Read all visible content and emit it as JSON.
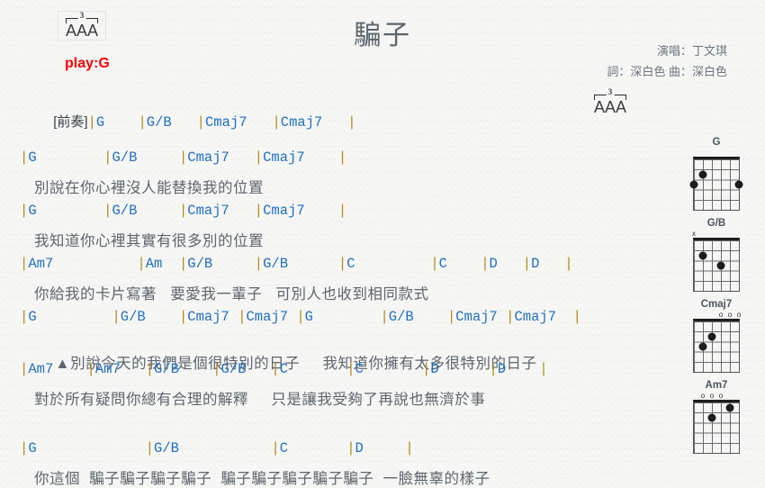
{
  "header": {
    "title": "騙子",
    "play_key": "play:G",
    "credit_singer": "演唱：丁文琪",
    "credit_writers": "詞：深白色   曲：深白色",
    "triplet_number": "3",
    "triplet_letters": "AAA"
  },
  "lines": [
    {
      "id": "intro-chords",
      "type": "chord",
      "tag": "[前奏]",
      "text": "|G    |G/B   |Cmaj7   |Cmaj7   |"
    },
    {
      "id": "verse1-chords-1",
      "type": "chord",
      "text": "|G        |G/B     |Cmaj7   |Cmaj7    |"
    },
    {
      "id": "verse1-lyric-1",
      "type": "lyric",
      "text": "別說在你心裡沒人能替換我的位置"
    },
    {
      "id": "verse1-chords-2",
      "type": "chord",
      "text": "|G        |G/B     |Cmaj7   |Cmaj7    |"
    },
    {
      "id": "verse1-lyric-2",
      "type": "lyric",
      "text": "我知道你心裡其實有很多別的位置"
    },
    {
      "id": "verse2-chords-1",
      "type": "chord",
      "text": "|Am7          |Am  |G/B     |G/B      |C         |C    |D   |D   |"
    },
    {
      "id": "verse2-lyric-1",
      "type": "lyric",
      "text": "你給我的卡片寫著   要愛我一輩子   可別人也收到相同款式"
    },
    {
      "id": "chorus-chords-1",
      "type": "chord",
      "text": "|G         |G/B    |Cmaj7 |Cmaj7 |G        |G/B    |Cmaj7 |Cmaj7  |"
    },
    {
      "id": "chorus-lyric-1",
      "type": "lyric",
      "marker": "▲",
      "text": "別說今天的我們是個很特別的日子     我知道你擁有太多很特別的日子"
    },
    {
      "id": "chorus-chords-2",
      "type": "chord",
      "text": "|Am7    |Am7   |G/B    |G/B   |C       |C       |D      |D    |"
    },
    {
      "id": "chorus-lyric-2",
      "type": "lyric",
      "text": "對於所有疑問你總有合理的解釋     只是讓我受夠了再說也無濟於事"
    },
    {
      "id": "outro-chords-1",
      "type": "chord",
      "text": "|G             |G/B           |C       |D     |"
    },
    {
      "id": "outro-lyric-1",
      "type": "lyric",
      "text": "你這個  騙子騙子騙子騙子  騙子騙子騙子騙子騙子  一臉無辜的樣子"
    }
  ],
  "chord_diagrams": [
    {
      "name": "G",
      "markers": [
        "",
        "",
        "",
        "",
        "",
        ""
      ],
      "dots": [
        {
          "string": 6,
          "fret": 3
        },
        {
          "string": 5,
          "fret": 2
        },
        {
          "string": 1,
          "fret": 3
        }
      ]
    },
    {
      "name": "G/B",
      "markers": [
        "x",
        "",
        "",
        "",
        "",
        ""
      ],
      "dots": [
        {
          "string": 5,
          "fret": 2
        },
        {
          "string": 3,
          "fret": 3
        }
      ]
    },
    {
      "name": "Cmaj7",
      "markers": [
        "",
        "",
        "",
        "o",
        "o",
        "o"
      ],
      "dots": [
        {
          "string": 5,
          "fret": 3
        },
        {
          "string": 4,
          "fret": 2
        }
      ]
    },
    {
      "name": "Am7",
      "markers": [
        "",
        "o",
        "o",
        "o",
        "",
        ""
      ],
      "dots": [
        {
          "string": 4,
          "fret": 2
        },
        {
          "string": 2,
          "fret": 1
        }
      ]
    }
  ],
  "colors": {
    "chord": "#1f6fc4",
    "barline": "#b58a18",
    "lyric": "#5c6670",
    "play_key": "#ff0000",
    "background": "#f7f7f5"
  }
}
